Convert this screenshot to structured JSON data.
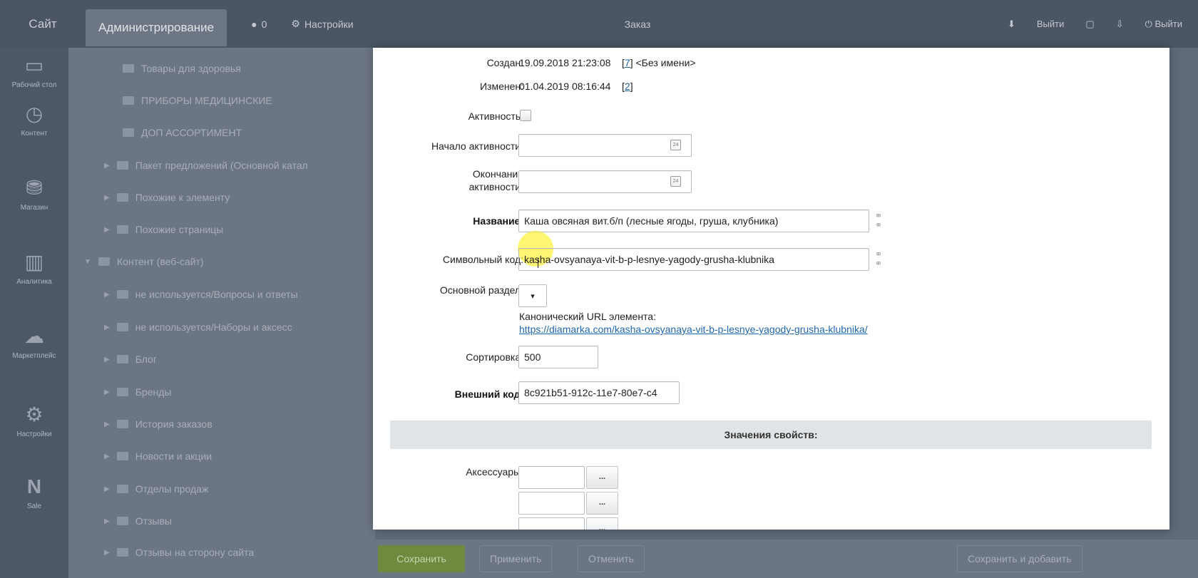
{
  "topbar": {
    "site": "Сайт",
    "admin": "Администрирование",
    "counter": "0",
    "settings": "Настройки",
    "center_item": "Заказ",
    "right_user": "Выйти",
    "logout": "Выйти"
  },
  "rail": [
    {
      "label": "Рабочий стол",
      "icon": "desktop-icon"
    },
    {
      "label": "Контент",
      "icon": "content-icon"
    },
    {
      "label": "Магазин",
      "icon": "shop-icon"
    },
    {
      "label": "Аналитика",
      "icon": "chart-icon"
    },
    {
      "label": "Маркетплейс",
      "icon": "cloud-icon"
    },
    {
      "label": "Настройки",
      "icon": "gear-icon"
    },
    {
      "label": "Sale",
      "icon": "n-logo-icon"
    }
  ],
  "tree": [
    "Товары для здоровья",
    "ПРИБОРЫ МЕДИЦИНСКИЕ",
    "ДОП АССОРТИМЕНТ",
    "Пакет предложений (Основной катал",
    "Похожие к элементу",
    "Похожие страницы",
    "Контент (веб-сайт)",
    "не используется/Вопросы и ответы",
    "не используется/Наборы и аксесс",
    "Блог",
    "Бренды",
    "История заказов",
    "Новости и акции",
    "Отделы продаж",
    "Отзывы",
    "Отзывы на сторону сайта"
  ],
  "bottom": {
    "save": "Сохранить",
    "apply": "Применить",
    "cancel": "Отменить",
    "save_add": "Сохранить и добавить"
  },
  "form": {
    "created_label": "Создан:",
    "created_value": "19.09.2018 21:23:08",
    "created_user_id": "7",
    "created_user_name": "<Без имени>",
    "modified_label": "Изменен:",
    "modified_value": "01.04.2019 08:16:44",
    "modified_user_id": "2",
    "active_label": "Активность:",
    "active_from_label": "Начало активности:",
    "active_from_value": "",
    "active_to_label_1": "Окончание",
    "active_to_label_2": "активности:",
    "active_to_value": "",
    "name_label": "Название:",
    "name_value": "Каша овсяная  вит.б/п (лесные ягоды, груша, клубника)",
    "code_label": "Символьный код:",
    "code_value": "kasha-ovsyanaya-vit-b-p-lesnye-yagody-grusha-klubnika",
    "section_label": "Основной раздел:",
    "section_value": "▾",
    "canonical_label": "Канонический URL элемента:",
    "canonical_url": "https://diamarka.com/kasha-ovsyanaya-vit-b-p-lesnye-yagody-grusha-klubnika/",
    "sort_label": "Сортировка:",
    "sort_value": "500",
    "xml_label": "Внешний код:",
    "xml_value": "8c921b51-912c-11e7-80e7-c4",
    "props_header": "Значения свойств:",
    "accessories_label": "Аксессуары:",
    "browse_label": "..."
  }
}
